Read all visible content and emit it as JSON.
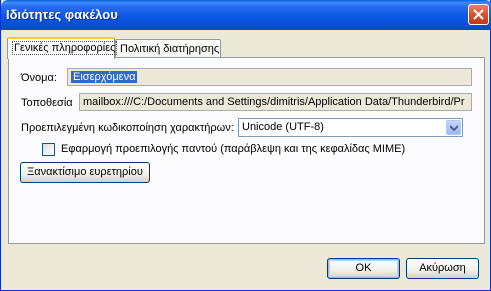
{
  "window": {
    "title": "Ιδιότητες φακέλου"
  },
  "tabs": [
    {
      "label": "Γενικές πληροφορίες",
      "active": true
    },
    {
      "label": "Πολιτική διατήρησης",
      "active": false
    }
  ],
  "general": {
    "name_label": "Όνομα:",
    "name_value": "Εισερχόμενα",
    "location_label": "Τοποθεσία",
    "location_value": "mailbox:///C:/Documents and Settings/dimitris/Application Data/Thunderbird/Pr",
    "encoding_label": "Προεπιλεγμένη κωδικοποίηση χαρακτήρων:",
    "encoding_value": "Unicode (UTF-8)",
    "apply_default_label": "Εφαρμογή προεπιλογής παντού (παράβλεψη και της κεφαλίδας MIME)",
    "apply_default_checked": false,
    "rebuild_index_label": "Ξανακτίσιμο ευρετηρίου"
  },
  "footer": {
    "ok_label": "OK",
    "cancel_label": "Ακύρωση"
  },
  "colors": {
    "titlebar": "#0a57e4",
    "dialog_bg": "#ece9d8",
    "selection": "#316ac5",
    "close_button": "#d6502c"
  }
}
